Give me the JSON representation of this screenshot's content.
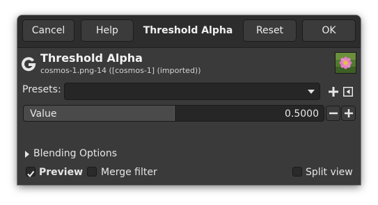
{
  "header": {
    "cancel_label": "Cancel",
    "help_label": "Help",
    "title": "Threshold Alpha",
    "reset_label": "Reset",
    "ok_label": "OK"
  },
  "operation": {
    "icon": "gimp-g-icon",
    "title": "Threshold Alpha",
    "subtitle": "cosmos-1.png-14 ([cosmos-1] (imported))",
    "thumbnail": "image-thumbnail"
  },
  "presets": {
    "label": "Presets:",
    "selected": "",
    "add_icon": "plus-icon",
    "menu_icon": "menu-icon"
  },
  "value": {
    "label": "Value",
    "display": "0.5000",
    "fraction": 0.5
  },
  "blending": {
    "label": "Blending Options",
    "expanded": false
  },
  "footer": {
    "preview_label": "Preview",
    "preview_checked": true,
    "merge_label": "Merge filter",
    "merge_checked": false,
    "split_label": "Split view",
    "split_checked": false
  },
  "colors": {
    "dialog_bg": "#3a3a3a",
    "header_bg": "#2d2d2d",
    "field_bg": "#262626",
    "text": "#e8e8e8"
  }
}
